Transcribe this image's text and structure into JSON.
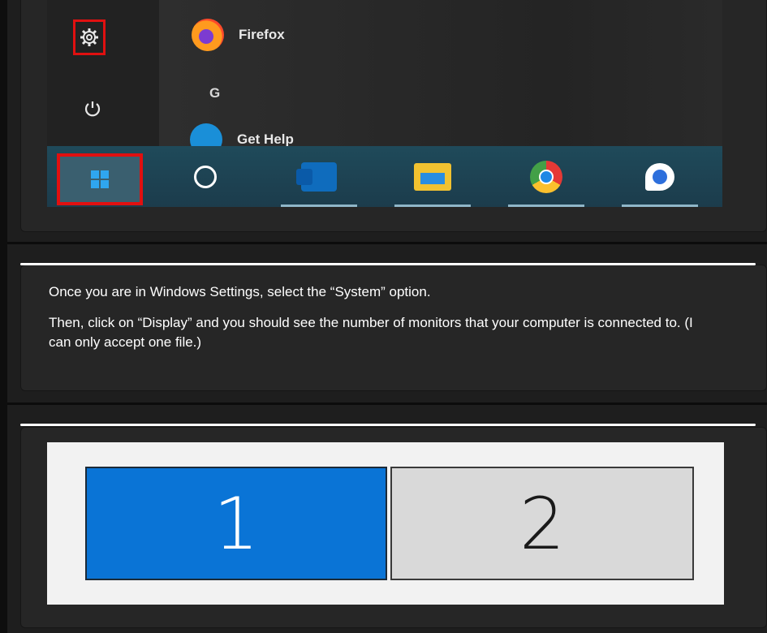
{
  "start_menu": {
    "apps": [
      {
        "label": "Firefox"
      },
      {
        "label": "Get Help"
      }
    ],
    "section_letter": "G",
    "rail_icons": [
      "gear-icon",
      "power-icon"
    ],
    "highlight_color": "#e01010"
  },
  "taskbar": {
    "items": [
      "windows-start-icon",
      "cortana-search-icon",
      "outlook-icon",
      "file-explorer-icon",
      "chrome-icon",
      "chat-app-icon"
    ]
  },
  "instructions": {
    "line1": "Once you are in Windows Settings, select the “System” option.",
    "line2": "Then, click on “Display” and you should see the number of monitors that your computer is connected to. (I can only accept one file.)"
  },
  "display": {
    "monitors": [
      {
        "label": "1",
        "selected": true
      },
      {
        "label": "2",
        "selected": false
      }
    ],
    "selected_color": "#0a74d6"
  }
}
